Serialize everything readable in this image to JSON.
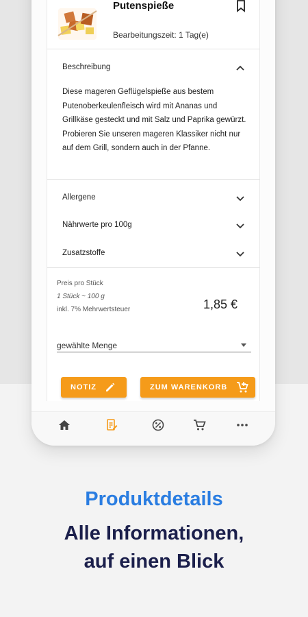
{
  "product": {
    "title": "Putenspieße",
    "prep_time": "Bearbeitungszeit: 1 Tag(e)",
    "bookmark_icon": "bookmark-icon",
    "thumbnail_icon": "skewer-image"
  },
  "accordion": {
    "description": {
      "label": "Beschreibung",
      "text": "Diese mageren Geflügelspieße aus bestem Putenoberkeulenfleisch wird mit Ananas und Grillkäse gesteckt und mit Salz und Paprika gewürzt. Probieren Sie unseren mageren Klassiker nicht nur auf dem Grill, sondern auch in der Pfanne."
    },
    "allergens": {
      "label": "Allergene"
    },
    "nutrition": {
      "label": "Nährwerte pro 100g"
    },
    "additives": {
      "label": "Zusatzstoffe"
    }
  },
  "price": {
    "per_piece_label": "Preis pro Stück",
    "unit_weight": "1 Stück ~ 100 g",
    "vat_note": "inkl. 7% Mehrwertsteuer",
    "value": "1,85 €"
  },
  "quantity": {
    "label": "gewählte Menge"
  },
  "buttons": {
    "note_label": "NOTIZ",
    "cart_label": "ZUM WARENKORB"
  },
  "nav": [
    "home-icon",
    "order-icon",
    "offers-icon",
    "cart-icon",
    "more-icon"
  ],
  "colors": {
    "accent": "#f59b1a",
    "headline_blue": "#2a7de1",
    "headline_navy": "#1b1f4b"
  },
  "tagline": {
    "line1": "Produktdetails",
    "line2": "Alle Informationen,",
    "line3": "auf einen Blick"
  }
}
